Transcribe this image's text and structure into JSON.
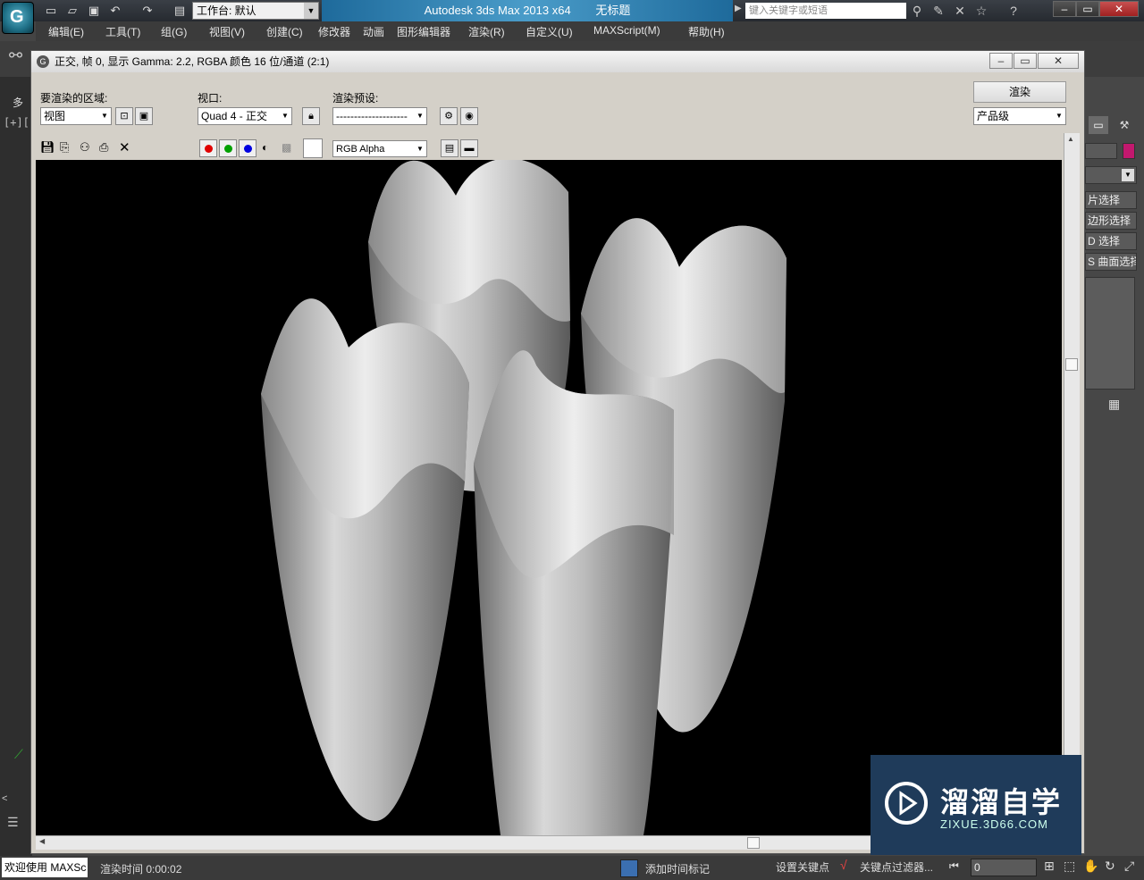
{
  "app": {
    "title": "Autodesk 3ds Max  2013 x64",
    "doc_title": "无标题",
    "workspace": "工作台: 默认",
    "search_placeholder": "键入关键字或短语"
  },
  "menu": [
    "编辑(E)",
    "工具(T)",
    "组(G)",
    "视图(V)",
    "创建(C)",
    "修改器",
    "动画",
    "图形编辑器",
    "渲染(R)",
    "自定义(U)",
    "MAXScript(M)",
    "帮助(H)"
  ],
  "render_window": {
    "caption": "正交, 帧 0, 显示 Gamma: 2.2, RGBA 颜色 16 位/通道 (2:1)",
    "area_label": "要渲染的区域:",
    "area_value": "视图",
    "viewport_label": "视口:",
    "viewport_value": "Quad 4 - 正交",
    "preset_label": "渲染预设:",
    "preset_value": "--------------------",
    "render_button": "渲染",
    "quality_value": "产品级",
    "channel_value": "RGB Alpha",
    "colors": {
      "red": "#e00000",
      "green": "#00a000",
      "blue": "#0000e0"
    }
  },
  "right_panel": [
    "片选择",
    "边形选择",
    "D 选择",
    "S 曲面选择"
  ],
  "status": {
    "welcome": "欢迎使用 MAXSc",
    "render_time": "渲染时间 0:00:02",
    "add_time_tag": "添加时间标记",
    "set_key": "设置关键点",
    "key_filter": "关键点过滤器...",
    "frame": "0"
  },
  "viewport_label": "[+][",
  "left_strip_label": "多",
  "watermark": {
    "name": "溜溜自学",
    "url": "ZIXUE.3D66.COM"
  }
}
